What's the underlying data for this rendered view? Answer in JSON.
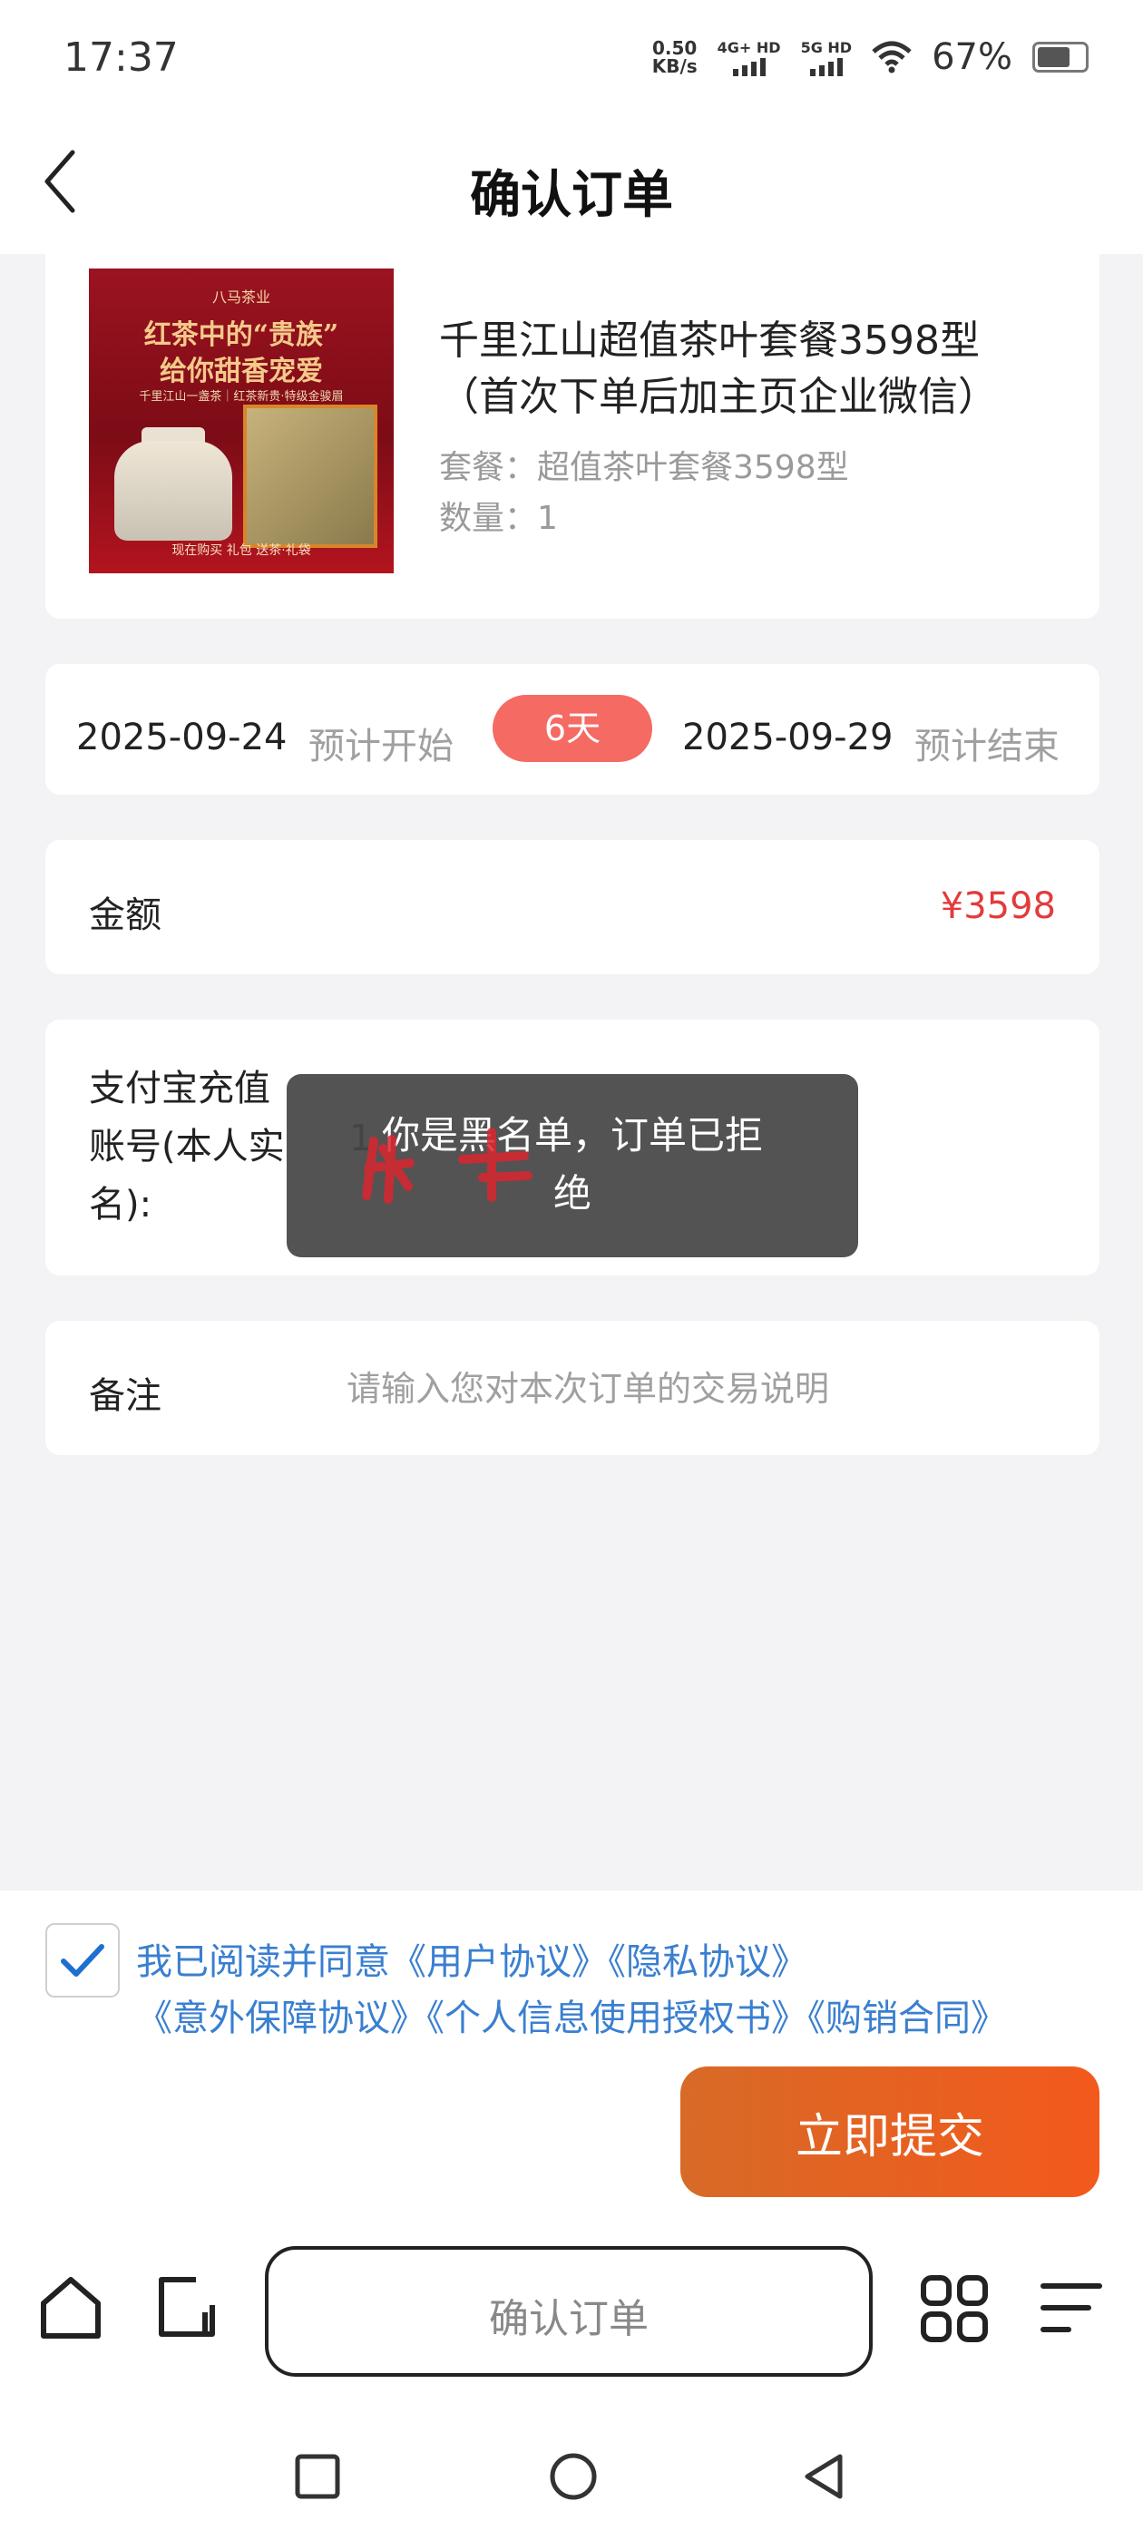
{
  "status_bar": {
    "time": "17:37",
    "net_speed_value": "0.50",
    "net_speed_unit": "KB/s",
    "sim1": "4G+ HD",
    "sim2": "5G HD",
    "battery": "67%"
  },
  "header": {
    "title": "确认订单",
    "back_icon": "chevron-left-icon"
  },
  "product": {
    "title_line1": "千里江山超值茶叶套餐3598型",
    "title_line2": "（首次下单后加主页企业微信）",
    "package_line": "套餐：超值茶叶套餐3598型",
    "quantity_line": "数量：1",
    "image": {
      "brand": "八马茶业",
      "headline1": "红茶中的“贵族”",
      "headline2": "给你甜香宠爱",
      "subline": "千里江山一盏茶｜红茶新贵·特级金骏眉",
      "bottom_text": "现在购买 礼包 送茶·礼袋"
    }
  },
  "dates": {
    "start_date": "2025-09-24",
    "start_label": "预计开始",
    "days": "6天",
    "end_date": "2025-09-29",
    "end_label": "预计结束"
  },
  "amount": {
    "label": "金额",
    "value": "¥3598"
  },
  "alipay": {
    "label_line1": "支付宝充值",
    "label_line2": "账号(本人实",
    "label_line3": "名):",
    "value": "1"
  },
  "remark": {
    "label": "备注",
    "placeholder": "请输入您对本次订单的交易说明"
  },
  "toast": {
    "line1": "你是黑名单，订单已拒",
    "line2": "绝"
  },
  "agreement": {
    "checked": true,
    "line1": "我已阅读并同意《用户协议》《隐私协议》",
    "line2": "《意外保障协议》《个人信息使用授权书》《购销合同》"
  },
  "submit": {
    "label": "立即提交"
  },
  "browser": {
    "address": "确认订单",
    "icons": [
      "home-icon",
      "tab-switch-icon",
      "apps-grid-icon",
      "menu-icon"
    ]
  },
  "system_nav": [
    "recent-apps-icon",
    "home-circle-icon",
    "back-triangle-icon"
  ],
  "colors": {
    "accent_red": "#e33b3b",
    "badge": "#f56a63",
    "link_blue": "#3a7fd0",
    "submit_gradient_start": "#d86a27",
    "submit_gradient_end": "#f3591c",
    "redaction": "#d9262f"
  }
}
